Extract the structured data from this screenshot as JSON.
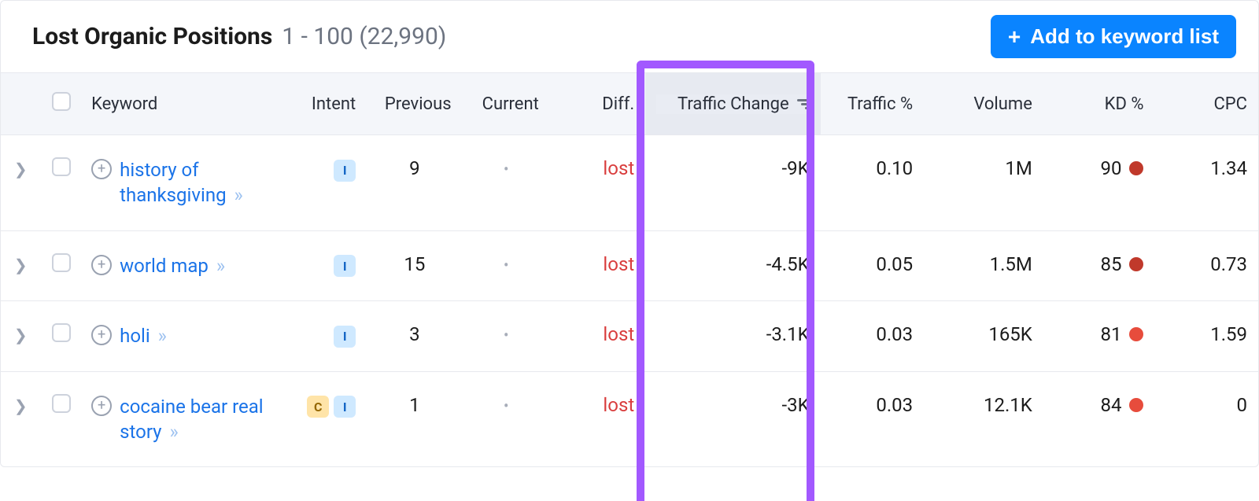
{
  "header": {
    "title": "Lost Organic Positions",
    "range": "1 - 100 (22,990)",
    "add_button": "Add to keyword list"
  },
  "columns": {
    "keyword": "Keyword",
    "intent": "Intent",
    "previous": "Previous",
    "current": "Current",
    "diff": "Diff.",
    "traffic_change": "Traffic Change",
    "traffic_pct": "Traffic %",
    "volume": "Volume",
    "kd_pct": "KD %",
    "cpc": "CPC"
  },
  "rows": [
    {
      "keyword": "history of thanksgiving",
      "intents": [
        "I"
      ],
      "previous": "9",
      "current": "·",
      "diff": "lost",
      "traffic_change": "-9K",
      "traffic_pct": "0.10",
      "volume": "1M",
      "kd": "90",
      "kd_color": "#c0392b",
      "cpc": "1.34"
    },
    {
      "keyword": "world map",
      "intents": [
        "I"
      ],
      "previous": "15",
      "current": "·",
      "diff": "lost",
      "traffic_change": "-4.5K",
      "traffic_pct": "0.05",
      "volume": "1.5M",
      "kd": "85",
      "kd_color": "#c0392b",
      "cpc": "0.73"
    },
    {
      "keyword": "holi",
      "intents": [
        "I"
      ],
      "previous": "3",
      "current": "·",
      "diff": "lost",
      "traffic_change": "-3.1K",
      "traffic_pct": "0.03",
      "volume": "165K",
      "kd": "81",
      "kd_color": "#e74c3c",
      "cpc": "1.59"
    },
    {
      "keyword": "cocaine bear real story",
      "intents": [
        "C",
        "I"
      ],
      "previous": "1",
      "current": "·",
      "diff": "lost",
      "traffic_change": "-3K",
      "traffic_pct": "0.03",
      "volume": "12.1K",
      "kd": "84",
      "kd_color": "#e74c3c",
      "cpc": "0"
    }
  ]
}
